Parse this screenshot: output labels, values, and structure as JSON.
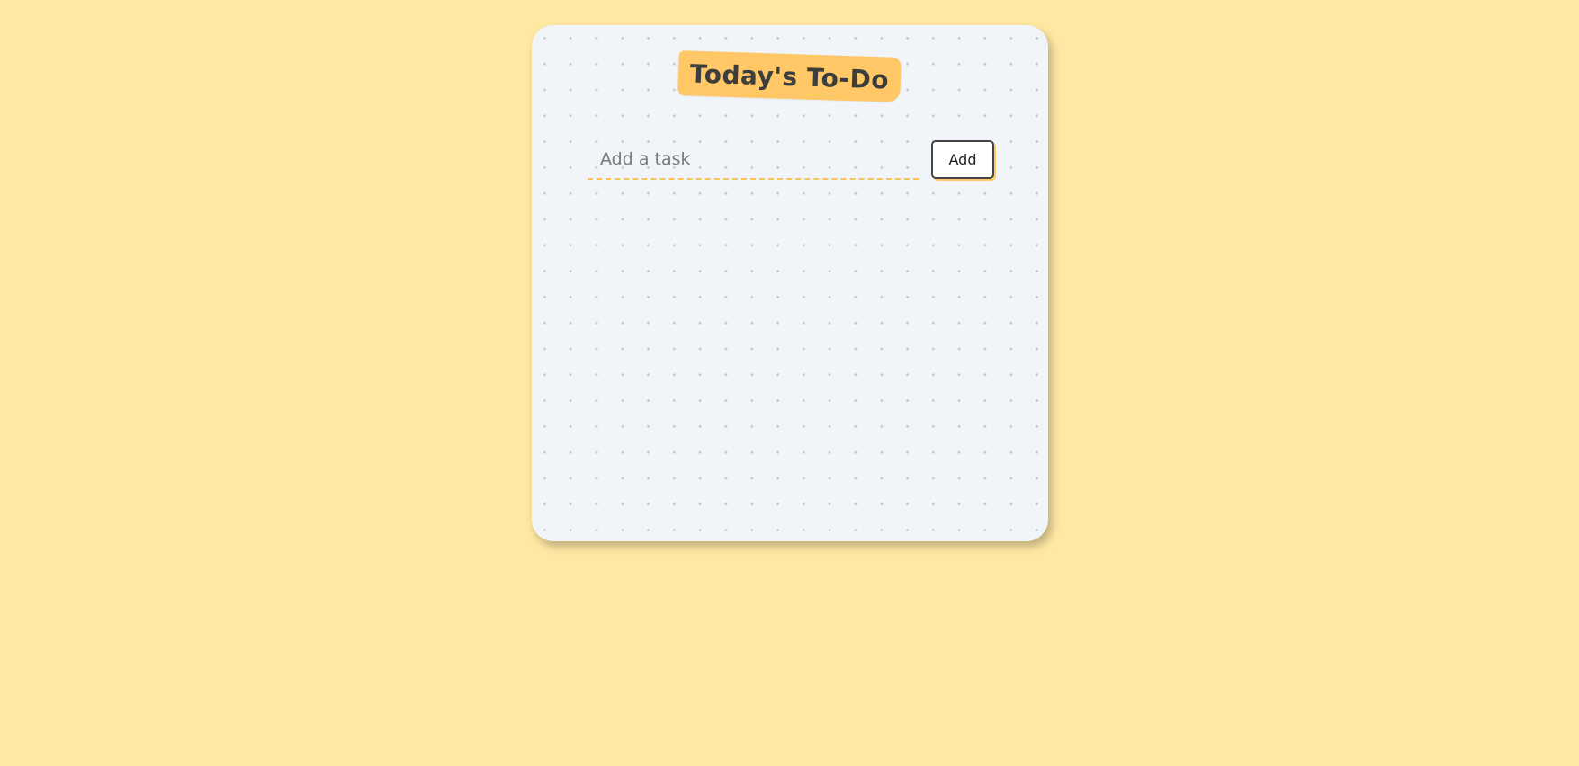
{
  "page": {
    "background_color": "#ffe8a3",
    "accent_color": "#ffc766"
  },
  "card": {
    "title": "Today's To-Do",
    "input": {
      "placeholder": "Add a task",
      "value": ""
    },
    "add_button_label": "Add",
    "tasks": []
  }
}
